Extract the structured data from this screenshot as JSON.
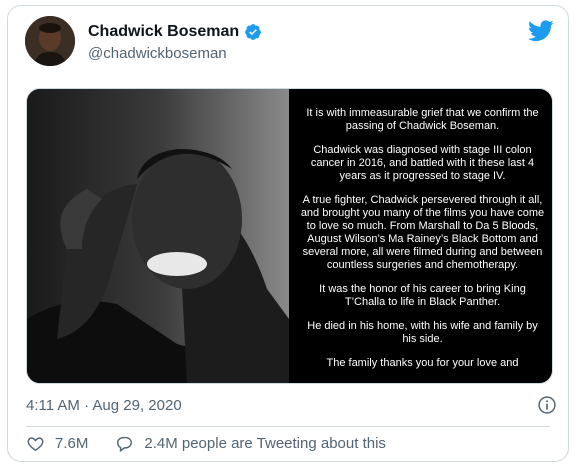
{
  "tweet": {
    "author_name": "Chadwick Boseman",
    "author_handle": "@chadwickboseman",
    "timestamp": "4:11 AM · Aug 29, 2020",
    "likes": "7.6M",
    "conversation": "2.4M people are Tweeting about this",
    "statement_paragraphs": [
      "It is with immeasurable grief that we confirm the passing of Chadwick Boseman.",
      "Chadwick was diagnosed with stage III colon cancer in 2016, and battled with it these last 4 years as it progressed to stage IV.",
      "A true fighter, Chadwick persevered through it all, and brought you many of the films you have come to love so much. From Marshall to Da 5 Bloods, August Wilson’s Ma Rainey’s Black Bottom and several more, all were filmed during and between countless surgeries and chemotherapy.",
      "It was the honor of his career to bring King T’Challa to life in Black Panther.",
      "He died in his home, with his wife and family by his side.",
      "The family thanks you for your love and"
    ]
  },
  "colors": {
    "twitter_blue": "#1d9bf0",
    "text_primary": "#0f1419",
    "text_secondary": "#536471",
    "border": "#cfd9de"
  },
  "icons": [
    "avatar",
    "verified-badge-icon",
    "twitter-bird-icon",
    "info-icon",
    "heart-icon",
    "speech-bubble-icon"
  ]
}
